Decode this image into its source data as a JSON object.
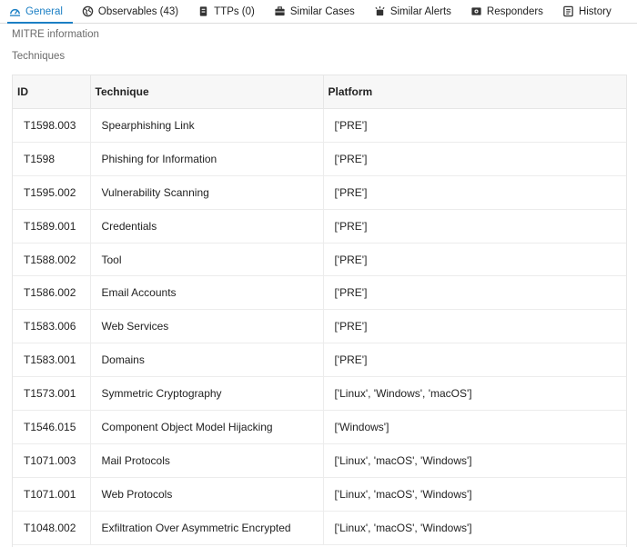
{
  "tabs": [
    {
      "label": "General",
      "icon": "dashboard-icon",
      "active": true
    },
    {
      "label": "Observables (43)",
      "icon": "globe-icon",
      "active": false
    },
    {
      "label": "TTPs (0)",
      "icon": "ttp-icon",
      "active": false
    },
    {
      "label": "Similar Cases",
      "icon": "briefcase-icon",
      "active": false
    },
    {
      "label": "Similar Alerts",
      "icon": "alerts-icon",
      "active": false
    },
    {
      "label": "Responders",
      "icon": "responders-icon",
      "active": false
    },
    {
      "label": "History",
      "icon": "history-icon",
      "active": false
    }
  ],
  "sections": {
    "mitre": "MITRE information",
    "techniques": "Techniques"
  },
  "table": {
    "headers": {
      "id": "ID",
      "technique": "Technique",
      "platform": "Platform"
    },
    "rows": [
      {
        "id": "T1598.003",
        "technique": "Spearphishing Link",
        "platform": "['PRE']"
      },
      {
        "id": "T1598",
        "technique": "Phishing for Information",
        "platform": "['PRE']"
      },
      {
        "id": "T1595.002",
        "technique": "Vulnerability Scanning",
        "platform": "['PRE']"
      },
      {
        "id": "T1589.001",
        "technique": "Credentials",
        "platform": "['PRE']"
      },
      {
        "id": "T1588.002",
        "technique": "Tool",
        "platform": "['PRE']"
      },
      {
        "id": "T1586.002",
        "technique": "Email Accounts",
        "platform": "['PRE']"
      },
      {
        "id": "T1583.006",
        "technique": "Web Services",
        "platform": "['PRE']"
      },
      {
        "id": "T1583.001",
        "technique": "Domains",
        "platform": "['PRE']"
      },
      {
        "id": "T1573.001",
        "technique": "Symmetric Cryptography",
        "platform": "['Linux', 'Windows', 'macOS']"
      },
      {
        "id": "T1546.015",
        "technique": "Component Object Model Hijacking",
        "platform": "['Windows']"
      },
      {
        "id": "T1071.003",
        "technique": "Mail Protocols",
        "platform": "['Linux', 'macOS', 'Windows']"
      },
      {
        "id": "T1071.001",
        "technique": "Web Protocols",
        "platform": "['Linux', 'macOS', 'Windows']"
      },
      {
        "id": "T1048.002",
        "technique": "Exfiltration Over Asymmetric Encrypted",
        "platform": "['Linux', 'macOS', 'Windows']"
      }
    ]
  },
  "colors": {
    "accent": "#1b7fc4"
  }
}
